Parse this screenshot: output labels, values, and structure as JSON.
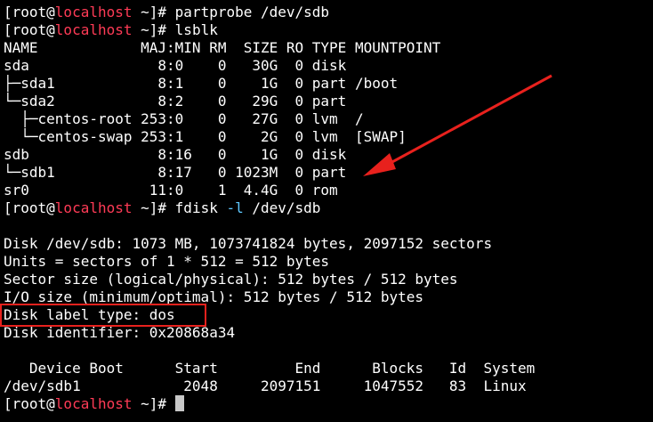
{
  "prompt": {
    "open": "[root@",
    "host": "localhost",
    "close": " ~]# "
  },
  "commands": {
    "partprobe": "partprobe /dev/sdb",
    "lsblk": "lsblk",
    "fdisk_cmd": "fdisk ",
    "fdisk_flag": "-l",
    "fdisk_arg": " /dev/sdb"
  },
  "lsblk": {
    "header": "NAME            MAJ:MIN RM  SIZE RO TYPE MOUNTPOINT",
    "rows": [
      "sda               8:0    0   30G  0 disk",
      "├─sda1            8:1    0    1G  0 part /boot",
      "└─sda2            8:2    0   29G  0 part",
      "  ├─centos-root 253:0    0   27G  0 lvm  /",
      "  └─centos-swap 253:1    0    2G  0 lvm  [SWAP]",
      "sdb               8:16   0    1G  0 disk",
      "└─sdb1            8:17   0 1023M  0 part",
      "sr0              11:0    1  4.4G  0 rom"
    ]
  },
  "fdisk": {
    "lines": [
      "",
      "Disk /dev/sdb: 1073 MB, 1073741824 bytes, 2097152 sectors",
      "Units = sectors of 1 * 512 = 512 bytes",
      "Sector size (logical/physical): 512 bytes / 512 bytes",
      "I/O size (minimum/optimal): 512 bytes / 512 bytes",
      "Disk label type: dos",
      "Disk identifier: 0x20868a34",
      "",
      "   Device Boot      Start         End      Blocks   Id  System",
      "/dev/sdb1            2048     2097151     1047552   83  Linux"
    ]
  },
  "colors": {
    "background": "#000000",
    "text": "#ffffff",
    "hostname": "#ff3b56",
    "flag": "#5fc8ff",
    "annotation": "#e8211d"
  }
}
